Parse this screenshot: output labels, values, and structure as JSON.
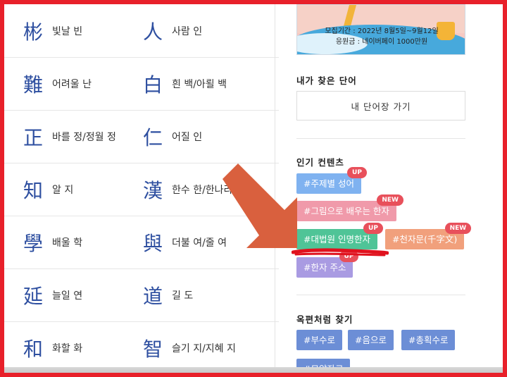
{
  "hanja_rows": [
    {
      "a": {
        "char": "彬",
        "meaning": "빛날 빈"
      },
      "b": {
        "char": "人",
        "meaning": "사람 인"
      }
    },
    {
      "a": {
        "char": "難",
        "meaning": "어려울 난"
      },
      "b": {
        "char": "白",
        "meaning": "흰 백/아뢸 백"
      }
    },
    {
      "a": {
        "char": "正",
        "meaning": "바를 정/정월 정"
      },
      "b": {
        "char": "仁",
        "meaning": "어질 인"
      }
    },
    {
      "a": {
        "char": "知",
        "meaning": "알 지"
      },
      "b": {
        "char": "漢",
        "meaning": "한수 한/한나라"
      }
    },
    {
      "a": {
        "char": "學",
        "meaning": "배울 학"
      },
      "b": {
        "char": "與",
        "meaning": "더불 여/줄 여"
      }
    },
    {
      "a": {
        "char": "延",
        "meaning": "늘일 연"
      },
      "b": {
        "char": "道",
        "meaning": "길 도"
      }
    },
    {
      "a": {
        "char": "和",
        "meaning": "화할 화"
      },
      "b": {
        "char": "智",
        "meaning": "슬기 지/지혜 지"
      }
    }
  ],
  "banner": {
    "line1": "모집기간 : 2022년 8월5일~9월12일",
    "line2": "응원금 : 네이버페이 1000만원"
  },
  "my_words": {
    "title": "내가 찾은 단어",
    "button": "내 단어장 가기"
  },
  "popular": {
    "title": "인기 컨텐츠",
    "tags": [
      {
        "label": "#주제별 성어",
        "badge": "UP",
        "color": "#7fb2f0"
      },
      {
        "label": "#그림으로 배우는 한자",
        "badge": "NEW",
        "color": "#f09aaa"
      },
      {
        "label": "#대법원 인명한자",
        "badge": "UP",
        "color": "#4fc497"
      },
      {
        "label": "#천자문(千字文)",
        "badge": "NEW",
        "color": "#f1a07c"
      },
      {
        "label": "#한자 주소",
        "badge": "UP",
        "color": "#a99be2"
      }
    ]
  },
  "find_like_dictionary": {
    "title": "옥편처럼 찾기",
    "buttons": [
      "#부수로",
      "#음으로",
      "#총획수로",
      "#모양자로"
    ]
  },
  "colors": {
    "frame": "#e8202a",
    "annotation_arrow": "#d9603e",
    "scribble": "#e0121e",
    "hanja": "#2e4fa0"
  }
}
